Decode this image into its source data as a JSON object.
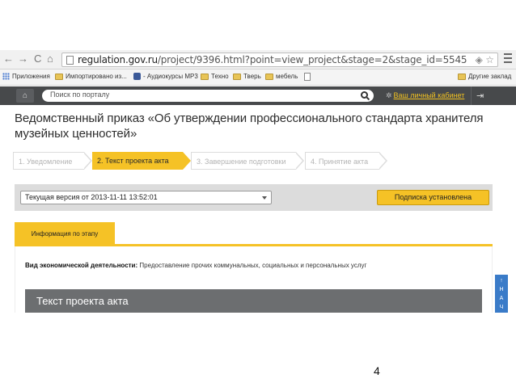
{
  "browser": {
    "nav_back": "←",
    "nav_forward": "→",
    "nav_reload": "C",
    "nav_home": "⌂",
    "url_host": "regulation.gov.ru",
    "url_path": "/project/9396.html?point=view_project&stage=2&stage_id=5545",
    "omni_icons": "◈ ☆"
  },
  "bookmarks": {
    "apps": "Приложения",
    "imported": "Импортировано из...",
    "audio": "- Аудиокурсы MP3",
    "tech": "Техно",
    "tver": "Тверь",
    "furniture": "мебель",
    "other": "Другие заклад"
  },
  "site_header": {
    "home_icon": "⌂",
    "search_placeholder": "Поиск по порталу",
    "cabinet_gear": "✲",
    "cabinet_label": "Ваш личный кабинет",
    "exit_icon": "⇥"
  },
  "page": {
    "title": "Ведомственный приказ «Об утверждении профессионального стандарта хранителя музейных ценностей»",
    "steps": [
      {
        "label": "1. Уведомление",
        "state": "inactive"
      },
      {
        "label": "2. Текст проекта акта",
        "state": "active"
      },
      {
        "label": "3. Завершение подготовки",
        "state": "inactive"
      },
      {
        "label": "4. Принятие акта",
        "state": "inactive"
      }
    ],
    "version_select": "Текущая версия от 2013-11-11 13:52:01",
    "subscribe_button": "Подписка установлена",
    "tab_label": "Информация по этапу",
    "activity_label": "Вид экономической деятельности:",
    "activity_value": "Предоставление прочих коммунальных, социальных и персональных услуг",
    "section_title": "Текст проекта акта",
    "side_button": [
      "↑",
      "Н",
      "А",
      "Ч"
    ]
  },
  "slide": {
    "page_number": "4"
  }
}
